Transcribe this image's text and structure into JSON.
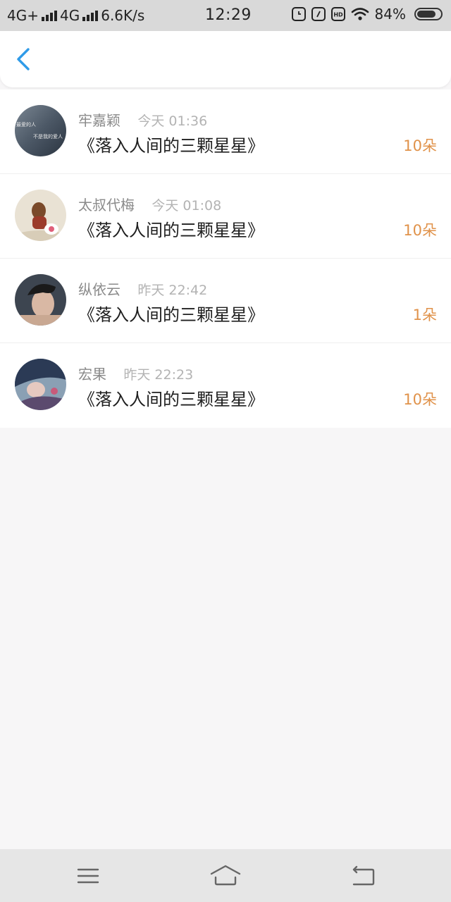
{
  "status_bar": {
    "network1": "4G+",
    "network2": "4G",
    "speed": "6.6K/s",
    "time": "12:29",
    "battery": "84%",
    "battery_level": 0.84
  },
  "header": {
    "back_icon": "chevron-left-icon"
  },
  "list": [
    {
      "name": "牢嘉颖",
      "time": "今天 01:36",
      "title": "《落入人间的三颗星星》",
      "count": "10朵",
      "avatar_text_1": "最爱的人",
      "avatar_text_2": "不是我的爱人"
    },
    {
      "name": "太叔代梅",
      "time": "今天 01:08",
      "title": "《落入人间的三颗星星》",
      "count": "10朵"
    },
    {
      "name": "纵依云",
      "time": "昨天 22:42",
      "title": "《落入人间的三颗星星》",
      "count": "1朵"
    },
    {
      "name": "宏果",
      "time": "昨天 22:23",
      "title": "《落入人间的三颗星星》",
      "count": "10朵"
    }
  ],
  "nav": {
    "menu_icon": "menu-icon",
    "home_icon": "home-icon",
    "back_icon": "back-arrow-icon"
  },
  "colors": {
    "accent": "#2f9be8",
    "count": "#e0924a",
    "background": "#f7f6f7"
  }
}
